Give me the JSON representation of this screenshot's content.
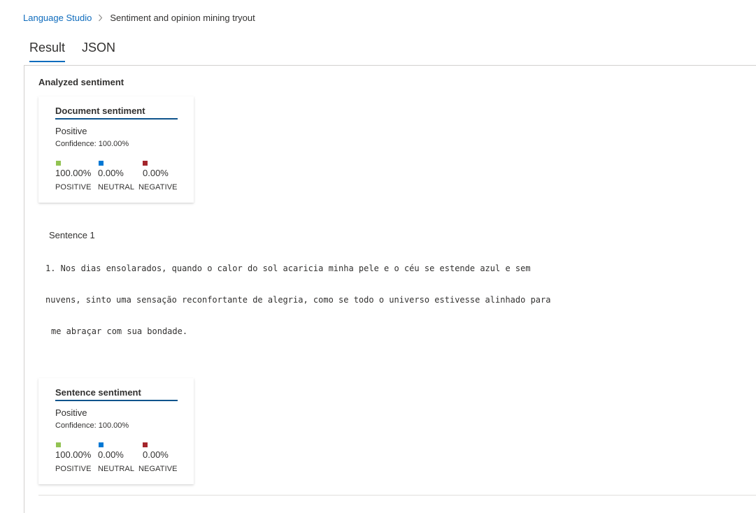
{
  "breadcrumb": {
    "root": "Language Studio",
    "current": "Sentiment and opinion mining tryout"
  },
  "tabs": [
    {
      "label": "Result",
      "active": true
    },
    {
      "label": "JSON",
      "active": false
    }
  ],
  "result": {
    "section_title": "Analyzed sentiment",
    "document_card": {
      "title": "Document sentiment",
      "sentiment": "Positive",
      "confidence_label": "Confidence:",
      "confidence_value": "100.00%",
      "scores": {
        "positive": {
          "value": "100.00%",
          "label": "POSITIVE",
          "color": "#92c353"
        },
        "neutral": {
          "value": "0.00%",
          "label": "NEUTRAL",
          "color": "#0078d4"
        },
        "negative": {
          "value": "0.00%",
          "label": "NEGATIVE",
          "color": "#a4262c"
        }
      }
    },
    "sentence": {
      "label": "Sentence 1",
      "lines": [
        "1. Nos dias ensolarados, quando o calor do sol acaricia minha pele e o céu se estende azul e sem",
        "nuvens, sinto uma sensação reconfortante de alegria, como se todo o universo estivesse alinhado para",
        "me abraçar com sua bondade."
      ]
    },
    "sentence_card": {
      "title": "Sentence sentiment",
      "sentiment": "Positive",
      "confidence_label": "Confidence:",
      "confidence_value": "100.00%",
      "scores": {
        "positive": {
          "value": "100.00%",
          "label": "POSITIVE",
          "color": "#92c353"
        },
        "neutral": {
          "value": "0.00%",
          "label": "NEUTRAL",
          "color": "#0078d4"
        },
        "negative": {
          "value": "0.00%",
          "label": "NEGATIVE",
          "color": "#a4262c"
        }
      }
    }
  },
  "icons": {
    "breadcrumb_separator": "chevron-right-icon"
  }
}
